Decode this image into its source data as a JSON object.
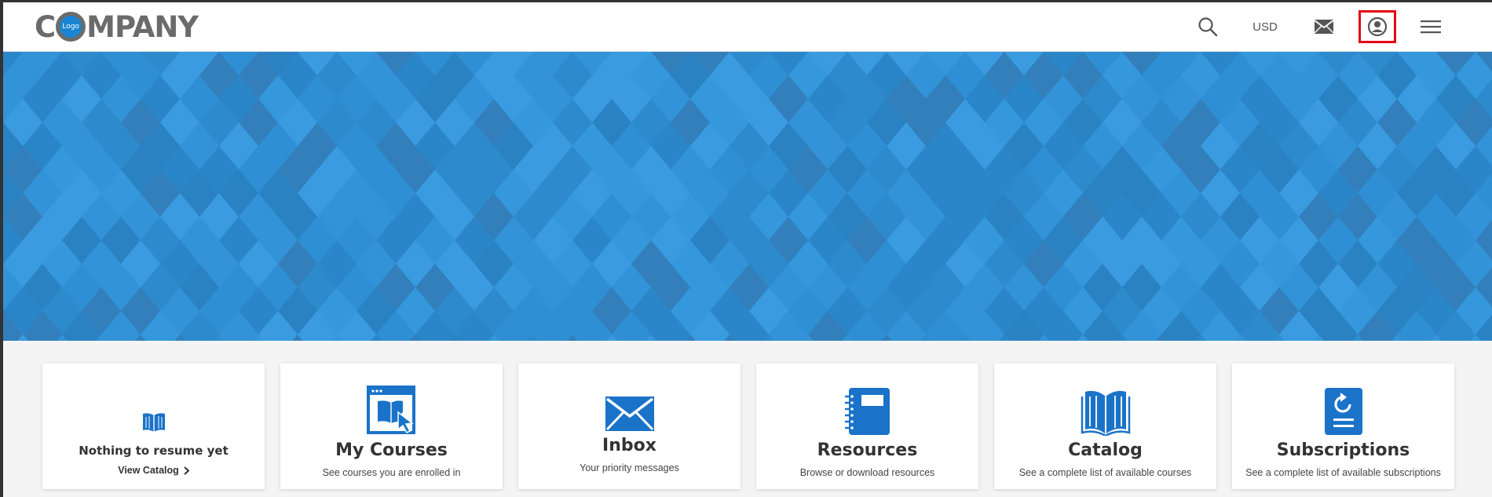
{
  "header": {
    "logo": {
      "text_before": "C",
      "badge": "Logo",
      "text_after": "MPANY"
    },
    "nav": {
      "search_icon": "search-icon",
      "currency": "USD",
      "mail_icon": "mail-icon",
      "account_icon": "user-circle-icon",
      "menu_icon": "hamburger-menu-icon"
    },
    "highlight_color": "#e30613"
  },
  "banner": {
    "base_color": "#2f8fd4",
    "pattern": "diamond-mosaic"
  },
  "cards": [
    {
      "id": "resume",
      "icon": "book-icon",
      "title": "Nothing to resume yet",
      "link": "View Catalog",
      "link_icon": "chevron-right-icon"
    },
    {
      "id": "my-courses",
      "icon": "course-window-cursor-icon",
      "title": "My Courses",
      "subtitle": "See courses you are enrolled in"
    },
    {
      "id": "inbox",
      "icon": "envelope-icon",
      "title": "Inbox",
      "subtitle": "Your priority messages"
    },
    {
      "id": "resources",
      "icon": "notebook-icon",
      "title": "Resources",
      "subtitle": "Browse or download resources"
    },
    {
      "id": "catalog",
      "icon": "open-book-icon",
      "title": "Catalog",
      "subtitle": "See a complete list of available courses"
    },
    {
      "id": "subscriptions",
      "icon": "refresh-list-icon",
      "title": "Subscriptions",
      "subtitle": "See a complete list of available subscriptions"
    }
  ],
  "colors": {
    "accent": "#1a73c8",
    "title_text": "#333333",
    "header_bg": "#ffffff"
  }
}
